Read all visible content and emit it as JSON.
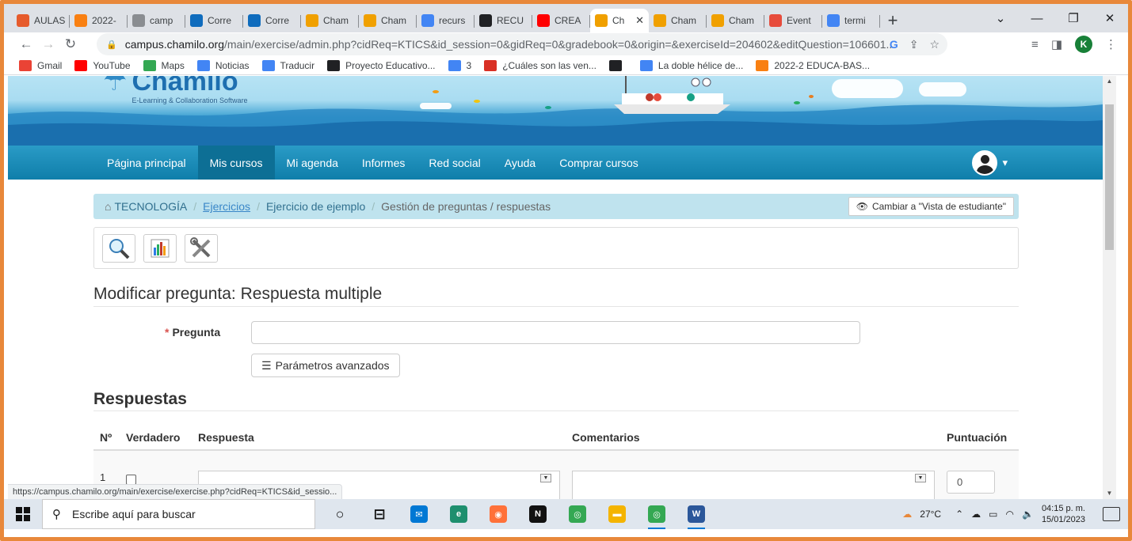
{
  "browser": {
    "tabs": [
      {
        "label": "AULAS",
        "icon": "joomla-icon",
        "color": "#e65b2c"
      },
      {
        "label": "2022-",
        "icon": "moodle-icon",
        "color": "#f98012"
      },
      {
        "label": "camp",
        "icon": "chamilo-icon",
        "color": "#8a8d91"
      },
      {
        "label": "Corre",
        "icon": "outlook-icon",
        "color": "#0f6cbd"
      },
      {
        "label": "Corre",
        "icon": "outlook-icon",
        "color": "#0f6cbd"
      },
      {
        "label": "Cham",
        "icon": "chamilo-icon",
        "color": "#f0a000"
      },
      {
        "label": "Cham",
        "icon": "chamilo-icon",
        "color": "#f0a000"
      },
      {
        "label": "recurs",
        "icon": "google-icon",
        "color": "#4285f4"
      },
      {
        "label": "RECU",
        "icon": "globe-icon",
        "color": "#202124"
      },
      {
        "label": "CREA",
        "icon": "youtube-icon",
        "color": "#ff0000"
      },
      {
        "label": "Ch",
        "icon": "chamilo-icon",
        "color": "#f0a000",
        "active": true
      },
      {
        "label": "Cham",
        "icon": "chamilo-icon",
        "color": "#f0a000"
      },
      {
        "label": "Cham",
        "icon": "chamilo-icon",
        "color": "#f0a000"
      },
      {
        "label": "Event",
        "icon": "edge-icon",
        "color": "#e74c3c"
      },
      {
        "label": "termi",
        "icon": "google-icon",
        "color": "#4285f4"
      }
    ],
    "close_glyph": "✕",
    "newtab_glyph": "+",
    "url_host": "campus.chamilo.org",
    "url_path": "/main/exercise/admin.php?cidReq=KTICS&id_session=0&gidReq=0&gradebook=0&origin=&exerciseId=204602&editQuestion=106601...",
    "profile_initial": "K",
    "bookmarks": [
      {
        "label": "Gmail",
        "icon": "gmail-icon",
        "color": "#ea4335"
      },
      {
        "label": "YouTube",
        "icon": "youtube-icon",
        "color": "#ff0000"
      },
      {
        "label": "Maps",
        "icon": "maps-icon",
        "color": "#34a853"
      },
      {
        "label": "Noticias",
        "icon": "news-icon",
        "color": "#4285f4"
      },
      {
        "label": "Traducir",
        "icon": "translate-icon",
        "color": "#4285f4"
      },
      {
        "label": "Proyecto Educativo...",
        "icon": "globe-icon",
        "color": "#202124"
      },
      {
        "label": "3",
        "icon": "google-icon",
        "color": "#4285f4"
      },
      {
        "label": "¿Cuáles son las ven...",
        "icon": "bookmark-red-icon",
        "color": "#d93025"
      },
      {
        "label": "",
        "icon": "globe-icon",
        "color": "#202124"
      },
      {
        "label": "La doble hélice de...",
        "icon": "image-icon",
        "color": "#4285f4"
      },
      {
        "label": "2022-2 EDUCA-BAS...",
        "icon": "moodle-icon",
        "color": "#f98012"
      }
    ]
  },
  "site": {
    "logo_title": "Chamilo",
    "logo_subtitle": "E-Learning & Collaboration Software",
    "nav": [
      {
        "label": "Página principal"
      },
      {
        "label": "Mis cursos",
        "active": true
      },
      {
        "label": "Mi agenda"
      },
      {
        "label": "Informes"
      },
      {
        "label": "Red social"
      },
      {
        "label": "Ayuda"
      },
      {
        "label": "Comprar cursos"
      }
    ],
    "user_caret": "▾"
  },
  "breadcrumb": {
    "course": "TECNOLOGÍA",
    "exercises": "Ejercicios",
    "exercise": "Ejercicio de ejemplo",
    "current": "Gestión de preguntas / respuestas",
    "student_view": "Cambiar a \"Vista de estudiante\""
  },
  "form": {
    "title": "Modificar pregunta: Respuesta multiple",
    "question_label": "Pregunta",
    "required_mark": "*",
    "question_value": "",
    "advanced_button": "Parámetros avanzados",
    "answers_title": "Respuestas",
    "columns": {
      "num": "Nº",
      "correct": "Verdadero",
      "answer": "Respuesta",
      "comments": "Comentarios",
      "score": "Puntuación"
    },
    "rows": [
      {
        "num": "1",
        "correct": false,
        "score": "0"
      }
    ]
  },
  "statusbar": {
    "link": "https://campus.chamilo.org/main/exercise/exercise.php?cidReq=KTICS&id_sessio..."
  },
  "taskbar": {
    "search_placeholder": "Escribe aquí para buscar",
    "apps": [
      {
        "name": "cortana-icon",
        "glyph": "○",
        "color": "transparent"
      },
      {
        "name": "task-view-icon",
        "glyph": "⊟",
        "color": "transparent"
      },
      {
        "name": "mail-icon",
        "glyph": "✉",
        "color": "#0078d4"
      },
      {
        "name": "edge-icon",
        "glyph": "e",
        "color": "#1e8f6e"
      },
      {
        "name": "firefox-icon",
        "glyph": "◉",
        "color": "#ff7139"
      },
      {
        "name": "netflix-icon",
        "glyph": "N",
        "color": "#111111"
      },
      {
        "name": "chrome-icon",
        "glyph": "◎",
        "color": "#34a853"
      },
      {
        "name": "file-explorer-icon",
        "glyph": "▬",
        "color": "#f4b400"
      },
      {
        "name": "chrome-profile-icon",
        "glyph": "◎",
        "color": "#34a853",
        "running": true
      },
      {
        "name": "word-icon",
        "glyph": "W",
        "color": "#2b579a",
        "running": true
      }
    ],
    "weather": "27°C",
    "time": "04:15 p. m.",
    "date": "15/01/2023"
  }
}
